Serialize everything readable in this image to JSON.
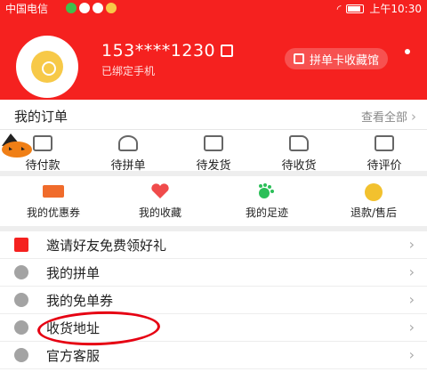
{
  "status_bar": {
    "carrier": "中国电信",
    "time": "上午10:30"
  },
  "profile": {
    "phone": "153****1230",
    "bound_text": "已绑定手机",
    "collect_button": "拼单卡收藏馆"
  },
  "orders": {
    "title": "我的订单",
    "view_all": "查看全部",
    "items": [
      {
        "label": "待付款",
        "icon": "wallet-icon"
      },
      {
        "label": "待拼单",
        "icon": "group-icon"
      },
      {
        "label": "待发货",
        "icon": "box-icon"
      },
      {
        "label": "待收货",
        "icon": "truck-icon"
      },
      {
        "label": "待评价",
        "icon": "review-icon"
      }
    ]
  },
  "services": {
    "items": [
      {
        "label": "我的优惠券",
        "icon": "coupon-icon",
        "color": "#f06b2b"
      },
      {
        "label": "我的收藏",
        "icon": "heart-icon",
        "color": "#f04b4b"
      },
      {
        "label": "我的足迹",
        "icon": "footprint-icon",
        "color": "#2bbf58"
      },
      {
        "label": "退款/售后",
        "icon": "refund-icon",
        "color": "#f2c12e"
      }
    ]
  },
  "menu": {
    "items": [
      {
        "label": "邀请好友免费领好礼",
        "icon": "gift-icon",
        "color": "#f5211f"
      },
      {
        "label": "我的拼单",
        "icon": "group-order-icon",
        "color": "#a3a3a3"
      },
      {
        "label": "我的免单券",
        "icon": "free-coupon-icon",
        "color": "#a3a3a3"
      },
      {
        "label": "收货地址",
        "icon": "location-icon",
        "color": "#a3a3a3"
      },
      {
        "label": "官方客服",
        "icon": "service-icon",
        "color": "#a3a3a3"
      }
    ]
  },
  "colors": {
    "brand": "#f5211f",
    "highlight": "#e60012"
  }
}
